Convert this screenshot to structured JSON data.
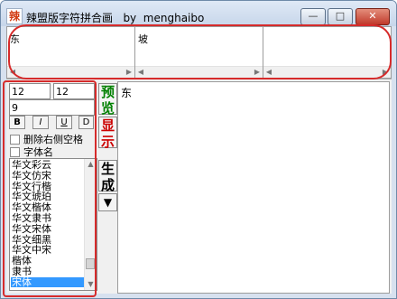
{
  "window": {
    "icon_glyph": "辣",
    "title": "辣盟版字符拼合画   by  menghaibo",
    "minimize_glyph": "—",
    "maximize_glyph": "□",
    "close_glyph": "✕"
  },
  "input_panes": [
    {
      "text": "东"
    },
    {
      "text": "坡"
    },
    {
      "text": ""
    }
  ],
  "controls": {
    "width_value": "12",
    "height_value": "12",
    "size_value": "9",
    "bold_label": "B",
    "italic_label": "I",
    "underline_label": "U",
    "strike_label": "D",
    "remove_trailing_space_label": "删除右侧空格",
    "font_name_label": "字体名"
  },
  "font_list": {
    "items": [
      "华文彩云",
      "华文仿宋",
      "华文行楷",
      "华文琥珀",
      "华文楷体",
      "华文隶书",
      "华文宋体",
      "华文细黑",
      "华文中宋",
      "楷体",
      "隶书",
      "宋体"
    ],
    "selected": "宋体"
  },
  "side_buttons": {
    "preview": "预览",
    "display": "显示",
    "generate": "生成",
    "dropdown_glyph": "▼"
  },
  "colors": {
    "preview_text": "#008000",
    "display_text": "#cc0000",
    "highlight": "#d62b2b"
  },
  "preview": {
    "text": "东"
  }
}
